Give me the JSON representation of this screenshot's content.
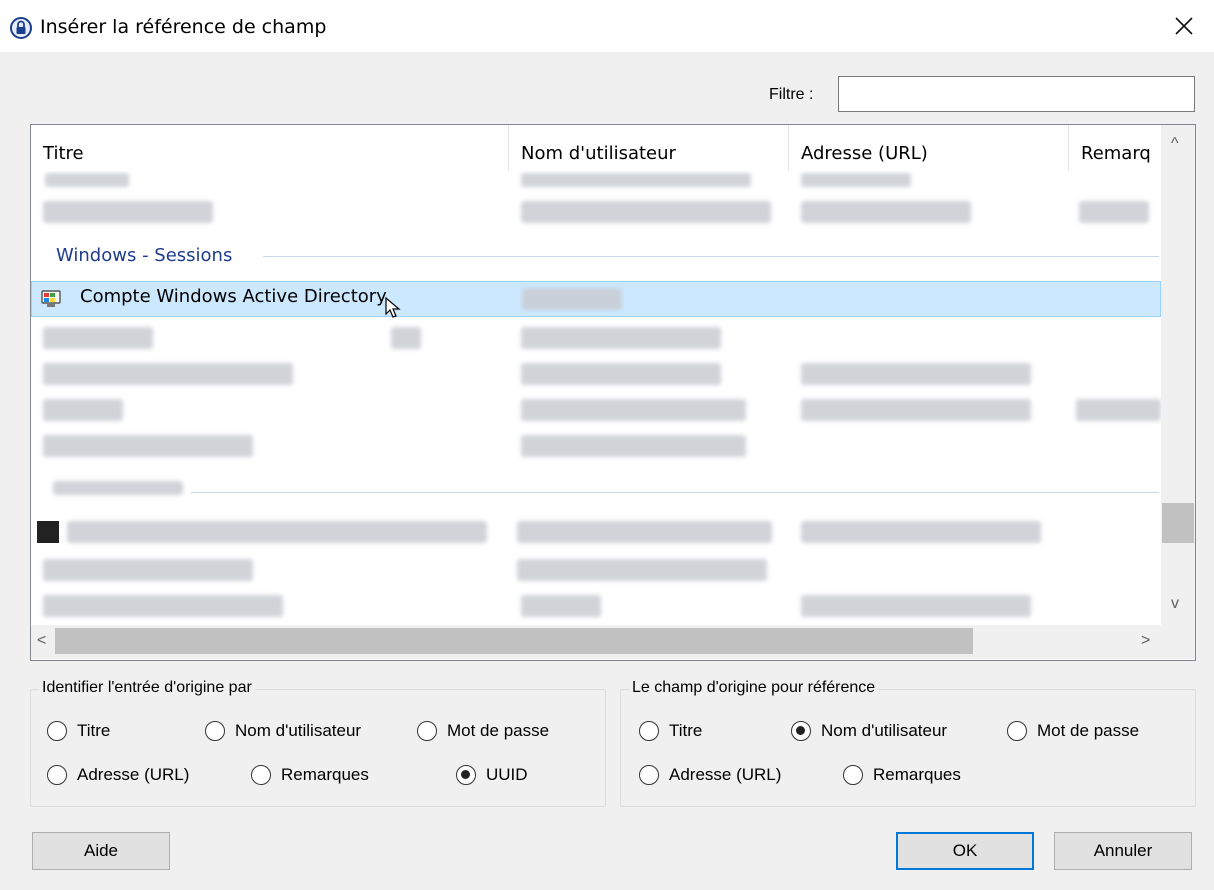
{
  "window": {
    "title": "Insérer la référence de champ",
    "close_icon": "close-icon",
    "lock_icon": "lock-icon"
  },
  "filter": {
    "label": "Filtre :",
    "value": ""
  },
  "list": {
    "columns": [
      "Titre",
      "Nom d'utilisateur",
      "Adresse (URL)",
      "Remarq"
    ],
    "group_label": "Windows - Sessions",
    "selected_entry": {
      "title": "Compte Windows Active Directory",
      "icon": "computer-icon"
    }
  },
  "source_group": {
    "title": "Identifier l'entrée d'origine par",
    "options": [
      "Titre",
      "Nom d'utilisateur",
      "Mot de passe",
      "Adresse (URL)",
      "Remarques",
      "UUID"
    ],
    "selected": "UUID"
  },
  "target_group": {
    "title": "Le champ d'origine pour référence",
    "options": [
      "Titre",
      "Nom d'utilisateur",
      "Mot de passe",
      "Adresse (URL)",
      "Remarques"
    ],
    "selected": "Nom d'utilisateur"
  },
  "buttons": {
    "help": "Aide",
    "ok": "OK",
    "cancel": "Annuler"
  },
  "scroll_arrows": {
    "up": "^",
    "down": "v",
    "left": "<",
    "right": ">"
  }
}
